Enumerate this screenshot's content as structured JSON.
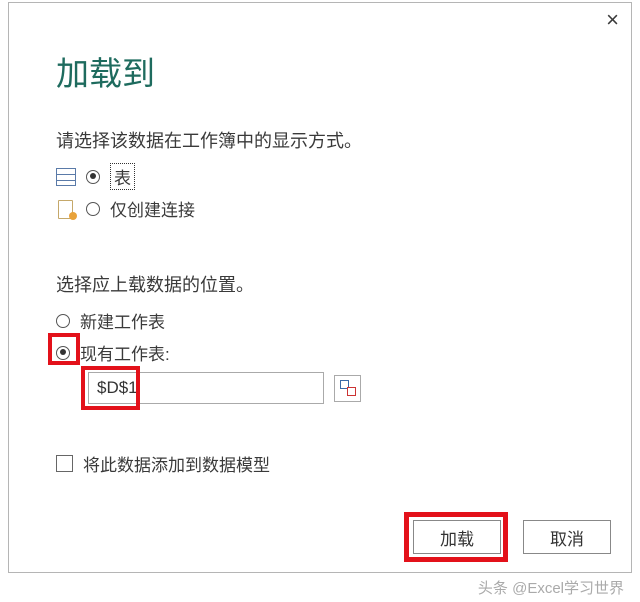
{
  "dialog": {
    "title": "加载到",
    "display_prompt": "请选择该数据在工作簿中的显示方式。",
    "option_table": "表",
    "option_connection": "仅创建连接",
    "location_prompt": "选择应上载数据的位置。",
    "option_new_sheet": "新建工作表",
    "option_existing_sheet": "现有工作表:",
    "cell_ref": "$D$1",
    "add_to_model": "将此数据添加到数据模型",
    "load_button": "加载",
    "cancel_button": "取消",
    "display_selected": "table",
    "location_selected": "existing"
  },
  "watermark": "头条 @Excel学习世界"
}
